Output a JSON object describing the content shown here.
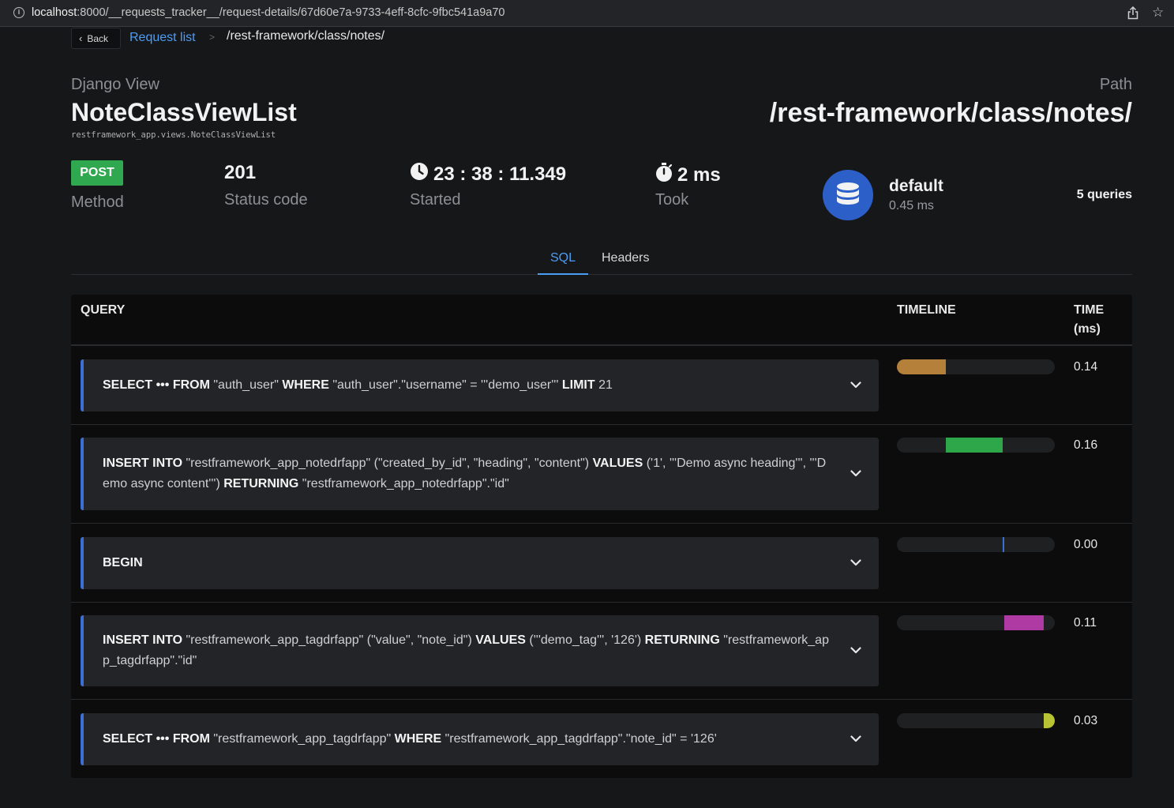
{
  "browser": {
    "url_host": "localhost",
    "url_rest": ":8000/__requests_tracker__/request-details/67d60e7a-9733-4eff-8cfc-9fbc541a9a70",
    "info_icon": "info-icon",
    "share_icon": "share-icon",
    "star_icon": "star-icon"
  },
  "breadcrumb": {
    "back_label": "Back",
    "list_label": "Request list",
    "separator": ">",
    "current": "/rest-framework/class/notes/"
  },
  "header": {
    "view_label": "Django View",
    "view_name": "NoteClassViewList",
    "view_module": "restframework_app.views.NoteClassViewList",
    "path_label": "Path",
    "path_value": "/rest-framework/class/notes/"
  },
  "stats": {
    "method": "POST",
    "method_label": "Method",
    "method_color": "#2fa84f",
    "status_code": "201",
    "status_label": "Status code",
    "started": "23 : 38 : 11.349",
    "started_label": "Started",
    "took": "2 ms",
    "took_label": "Took"
  },
  "database": {
    "name": "default",
    "time": "0.45 ms",
    "queries": "5 queries",
    "icon": "database-icon",
    "color": "#2d5fc9"
  },
  "tabs": [
    {
      "label": "SQL",
      "active": true
    },
    {
      "label": "Headers",
      "active": false
    }
  ],
  "table": {
    "headers": {
      "query": "QUERY",
      "timeline": "TIMELINE",
      "time_line1": "TIME",
      "time_line2": "(ms)"
    },
    "rows": [
      {
        "segments": [
          {
            "t": "SELECT ••• FROM ",
            "kw": true
          },
          {
            "t": "\"auth_user\" ",
            "kw": false
          },
          {
            "t": "WHERE ",
            "kw": true
          },
          {
            "t": "\"auth_user\".\"username\" = '''demo_user''' ",
            "kw": false
          },
          {
            "t": "LIMIT ",
            "kw": true
          },
          {
            "t": "21",
            "kw": false
          }
        ],
        "time": "0.14",
        "timeline": {
          "start": 0.0,
          "end": 0.31,
          "color": "#b5803a"
        }
      },
      {
        "segments": [
          {
            "t": "INSERT INTO ",
            "kw": true
          },
          {
            "t": "\"restframework_app_notedrfapp\" (\"created_by_id\", \"heading\", \"content\") ",
            "kw": false
          },
          {
            "t": "VALUES ",
            "kw": true
          },
          {
            "t": "('1', '''Demo async heading''', '''Demo async content''') ",
            "kw": false
          },
          {
            "t": "RETURNING ",
            "kw": true
          },
          {
            "t": "\"restframework_app_notedrfapp\".\"id\"",
            "kw": false
          }
        ],
        "time": "0.16",
        "timeline": {
          "start": 0.31,
          "end": 0.67,
          "color": "#2ea64a"
        }
      },
      {
        "segments": [
          {
            "t": "BEGIN",
            "kw": true
          }
        ],
        "time": "0.00",
        "timeline": {
          "start": 0.67,
          "end": 0.68,
          "color": "#3b6fd4"
        }
      },
      {
        "segments": [
          {
            "t": "INSERT INTO ",
            "kw": true
          },
          {
            "t": "\"restframework_app_tagdrfapp\" (\"value\", \"note_id\") ",
            "kw": false
          },
          {
            "t": "VALUES ",
            "kw": true
          },
          {
            "t": "('''demo_tag''', '126') ",
            "kw": false
          },
          {
            "t": "RETURNING ",
            "kw": true
          },
          {
            "t": "\"restframework_app_tagdrfapp\".\"id\"",
            "kw": false
          }
        ],
        "time": "0.11",
        "timeline": {
          "start": 0.68,
          "end": 0.93,
          "color": "#b03aa4"
        }
      },
      {
        "segments": [
          {
            "t": "SELECT ••• FROM ",
            "kw": true
          },
          {
            "t": "\"restframework_app_tagdrfapp\" ",
            "kw": false
          },
          {
            "t": "WHERE ",
            "kw": true
          },
          {
            "t": "\"restframework_app_tagdrfapp\".\"note_id\" = '126'",
            "kw": false
          }
        ],
        "time": "0.03",
        "timeline": {
          "start": 0.93,
          "end": 1.0,
          "color": "#b8c433"
        }
      }
    ]
  }
}
